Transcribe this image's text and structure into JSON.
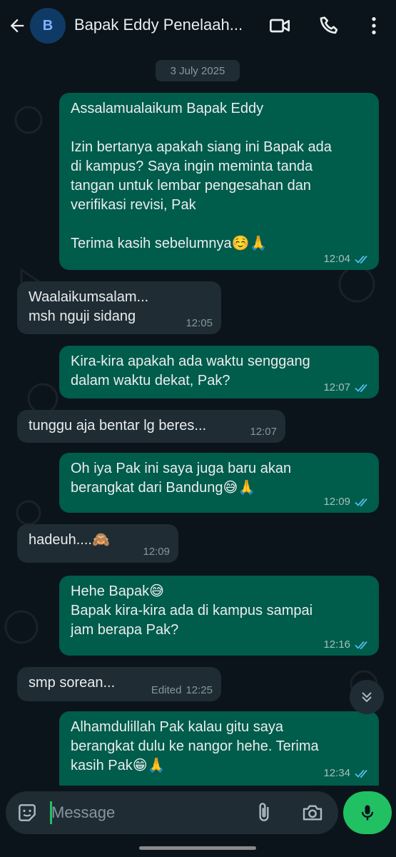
{
  "header": {
    "avatar_letter": "B",
    "contact_name": "Bapak Eddy Penelaah...",
    "icons": [
      "back-arrow-icon",
      "video-call-icon",
      "phone-icon",
      "more-vert-icon"
    ]
  },
  "chat": {
    "date_label": "3 July 2025",
    "messages": [
      {
        "direction": "outgoing",
        "lines": [
          "Assalamualaikum Bapak Eddy",
          "",
          "Izin bertanya apakah siang ini Bapak ada",
          "di kampus? Saya ingin meminta tanda",
          "tangan untuk lembar pengesahan dan",
          "verifikasi revisi, Pak",
          "",
          "Terima kasih sebelumnya☺️🙏"
        ],
        "time": "12:04",
        "status": "read"
      },
      {
        "direction": "incoming",
        "lines": [
          "Waalaikumsalam...",
          "msh nguji sidang"
        ],
        "time": "12:05"
      },
      {
        "direction": "outgoing",
        "lines": [
          "Kira-kira apakah ada waktu senggang",
          "dalam waktu dekat, Pak?"
        ],
        "time": "12:07",
        "status": "read"
      },
      {
        "direction": "incoming",
        "lines": [
          "tunggu aja bentar lg beres..."
        ],
        "time": "12:07"
      },
      {
        "direction": "outgoing",
        "lines": [
          "Oh iya Pak ini saya juga baru akan",
          "berangkat dari Bandung😅🙏"
        ],
        "time": "12:09",
        "status": "read"
      },
      {
        "direction": "incoming",
        "lines": [
          "hadeuh....🙈"
        ],
        "time": "12:09"
      },
      {
        "direction": "outgoing",
        "lines": [
          "Hehe Bapak😅",
          "Bapak kira-kira ada di kampus sampai",
          "jam berapa Pak?"
        ],
        "time": "12:16",
        "status": "read"
      },
      {
        "direction": "incoming",
        "lines": [
          "smp sorean..."
        ],
        "edited_label": "Edited",
        "time": "12:25"
      },
      {
        "direction": "outgoing",
        "lines": [
          "Alhamdulillah Pak kalau gitu saya",
          "berangkat dulu ke nangor hehe. Terima",
          "kasih Pak😁🙏"
        ],
        "time": "12:34",
        "status": "read"
      }
    ]
  },
  "composer": {
    "placeholder": "Message",
    "icons": [
      "emoji-sticker-icon",
      "attach-icon",
      "camera-icon",
      "mic-icon",
      "scroll-down-icon"
    ]
  },
  "colors": {
    "background": "#0b141a",
    "outgoing_bubble": "#005c4b",
    "incoming_bubble": "#1f2c33",
    "read_tick": "#53bdeb",
    "accent_green": "#21c063"
  }
}
